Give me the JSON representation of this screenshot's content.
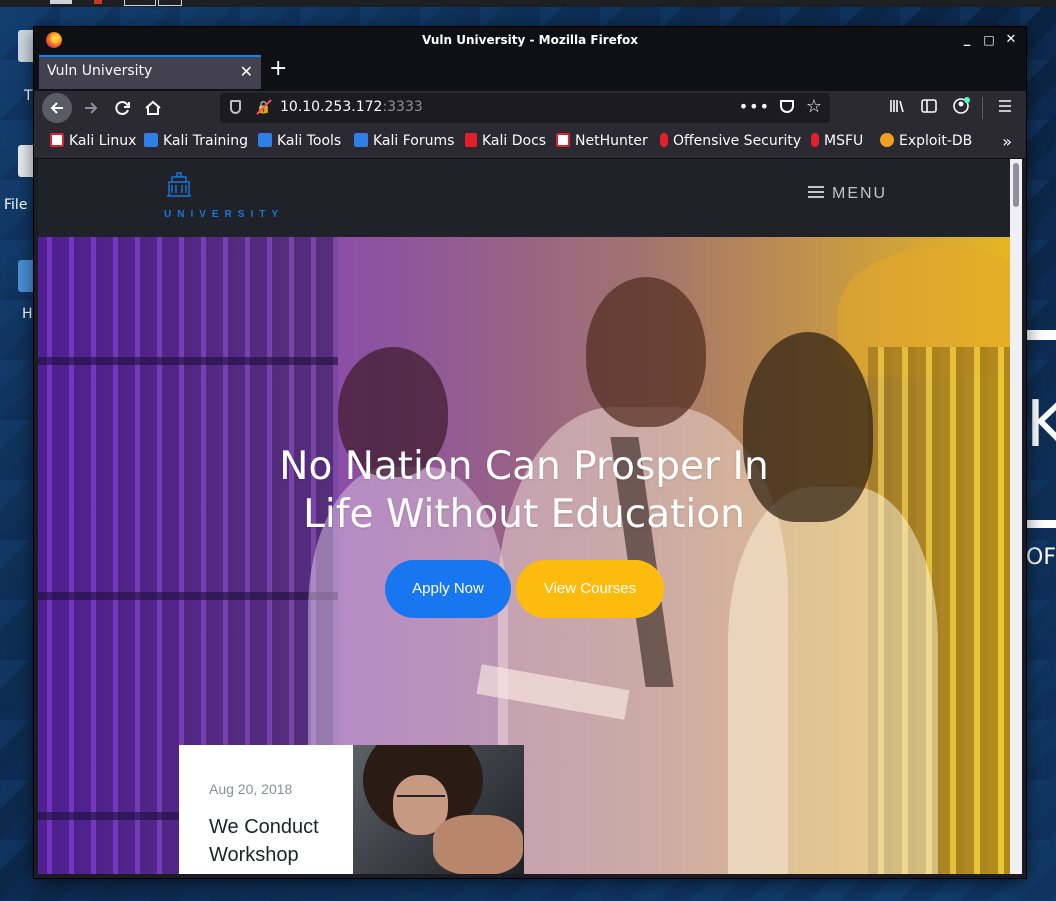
{
  "desktop": {
    "labels": [
      "T",
      "File",
      "H"
    ]
  },
  "window": {
    "title": "Vuln University - Mozilla Firefox",
    "minimize": "_",
    "maximize": "□",
    "close": "✕"
  },
  "tabs": [
    {
      "label": "Vuln University",
      "close": "✕",
      "active": true
    }
  ],
  "newtab_label": "+",
  "navigation": {
    "url_host": "10.10.253.172",
    "url_port": ":3333",
    "more_dots": "•••"
  },
  "bookmarks": [
    {
      "label": "Kali Linux",
      "icon": "kali-icon",
      "color": "#e2202b"
    },
    {
      "label": "Kali Training",
      "icon": "kali-training-icon",
      "color": "#2f7fe8"
    },
    {
      "label": "Kali Tools",
      "icon": "kali-tools-icon",
      "color": "#2f7fe8"
    },
    {
      "label": "Kali Forums",
      "icon": "kali-forums-icon",
      "color": "#2f7fe8"
    },
    {
      "label": "Kali Docs",
      "icon": "kali-docs-icon",
      "color": "#e2202b"
    },
    {
      "label": "NetHunter",
      "icon": "nethunter-icon",
      "color": "#e2202b"
    },
    {
      "label": "Offensive Security",
      "icon": "offsec-icon",
      "color": "#e2202b"
    },
    {
      "label": "MSFU",
      "icon": "msfu-icon",
      "color": "#e2202b"
    },
    {
      "label": "Exploit-DB",
      "icon": "exploitdb-icon",
      "color": "#f0a020"
    }
  ],
  "site": {
    "logo_text": "UNIVERSITY",
    "menu_label": "MENU",
    "brand_color": "#1877dd",
    "hero": {
      "title_line1": "No Nation Can Prosper In",
      "title_line2": "Life Without Education",
      "apply_label": "Apply Now",
      "courses_label": "View Courses",
      "apply_color": "#1877f0",
      "courses_color": "#fdbc0d"
    },
    "event": {
      "date": "Aug 20, 2018",
      "title": "We Conduct Workshop"
    }
  }
}
